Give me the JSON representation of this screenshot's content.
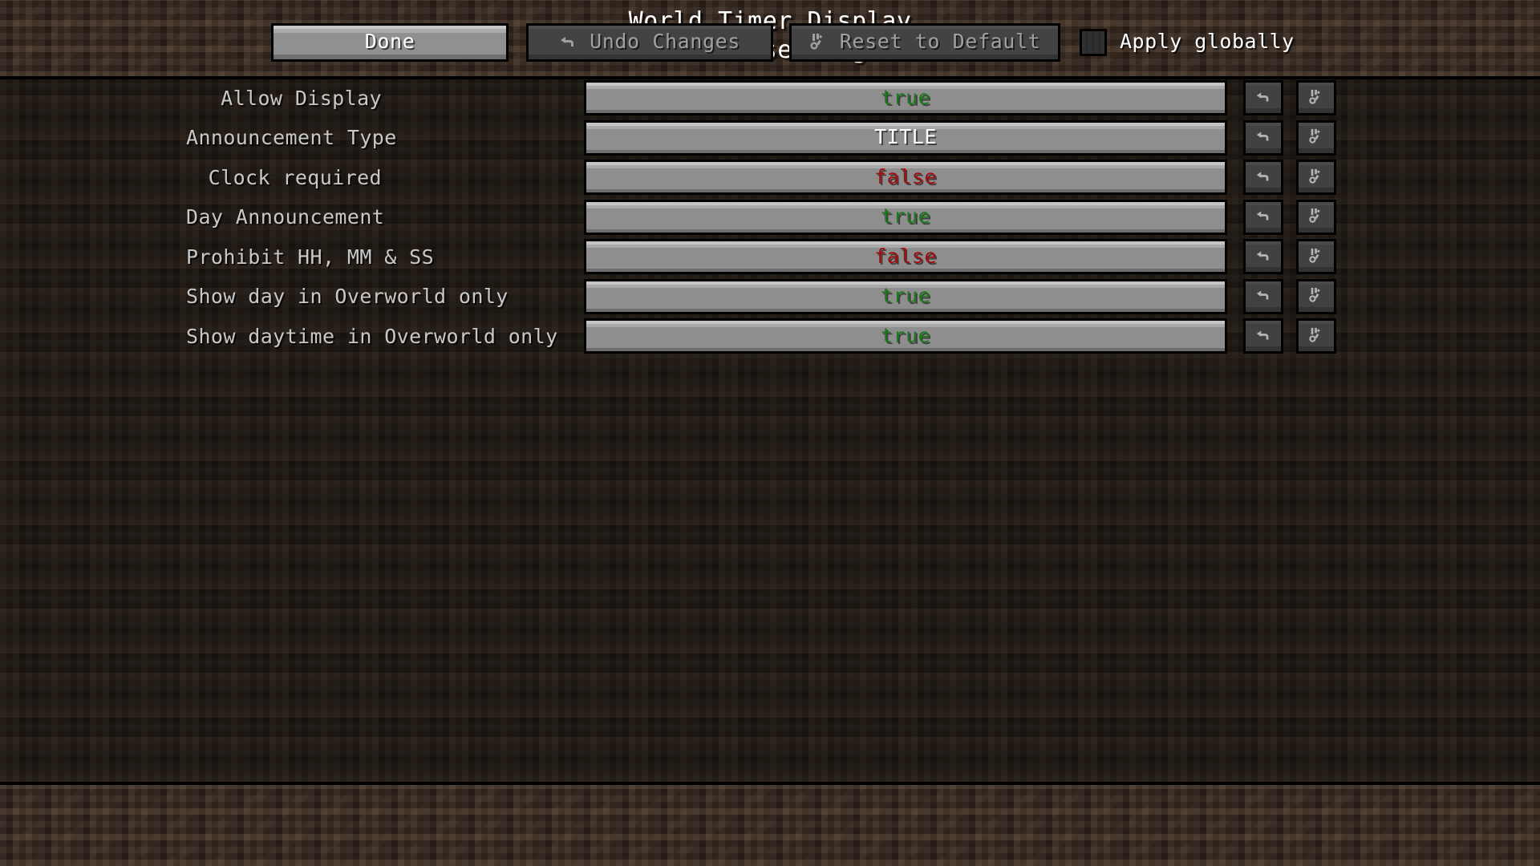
{
  "header": {
    "title_line_1": "World Timer Display",
    "title_line_2": "server settings"
  },
  "settings": {
    "rows": [
      {
        "label": "Allow Display",
        "value": "true",
        "value_type": "true",
        "undo_icon": "undo-arrow-icon",
        "reset_icon": "reset-default-icon"
      },
      {
        "label": "Announcement Type",
        "value": "TITLE",
        "value_type": "plain",
        "undo_icon": "undo-arrow-icon",
        "reset_icon": "reset-default-icon"
      },
      {
        "label": "Clock required",
        "value": "false",
        "value_type": "false",
        "undo_icon": "undo-arrow-icon",
        "reset_icon": "reset-default-icon"
      },
      {
        "label": "Day Announcement",
        "value": "true",
        "value_type": "true",
        "undo_icon": "undo-arrow-icon",
        "reset_icon": "reset-default-icon"
      },
      {
        "label": "Prohibit HH, MM & SS",
        "value": "false",
        "value_type": "false",
        "undo_icon": "undo-arrow-icon",
        "reset_icon": "reset-default-icon"
      },
      {
        "label": "Show day in Overworld only",
        "value": "true",
        "value_type": "true",
        "undo_icon": "undo-arrow-icon",
        "reset_icon": "reset-default-icon"
      },
      {
        "label": "Show daytime in Overworld only",
        "value": "true",
        "value_type": "true",
        "undo_icon": "undo-arrow-icon",
        "reset_icon": "reset-default-icon"
      }
    ]
  },
  "footer": {
    "done_label": "Done",
    "undo_changes_label": "Undo Changes",
    "undo_changes_icon": "undo-arrow-icon",
    "reset_default_label": "Reset to Default",
    "reset_default_icon": "reset-default-icon",
    "apply_globally_label": "Apply globally",
    "apply_globally_checked": false
  },
  "colors": {
    "value_true": "#1f7a1f",
    "value_false": "#a01010",
    "value_plain": "#ffffff",
    "label_text": "#c8c8c8",
    "title_text": "#ffffff",
    "background_dark": "#19140f",
    "background_brown": "#33261d",
    "button_light": "#8e8e8e",
    "button_dark": "#414141"
  }
}
